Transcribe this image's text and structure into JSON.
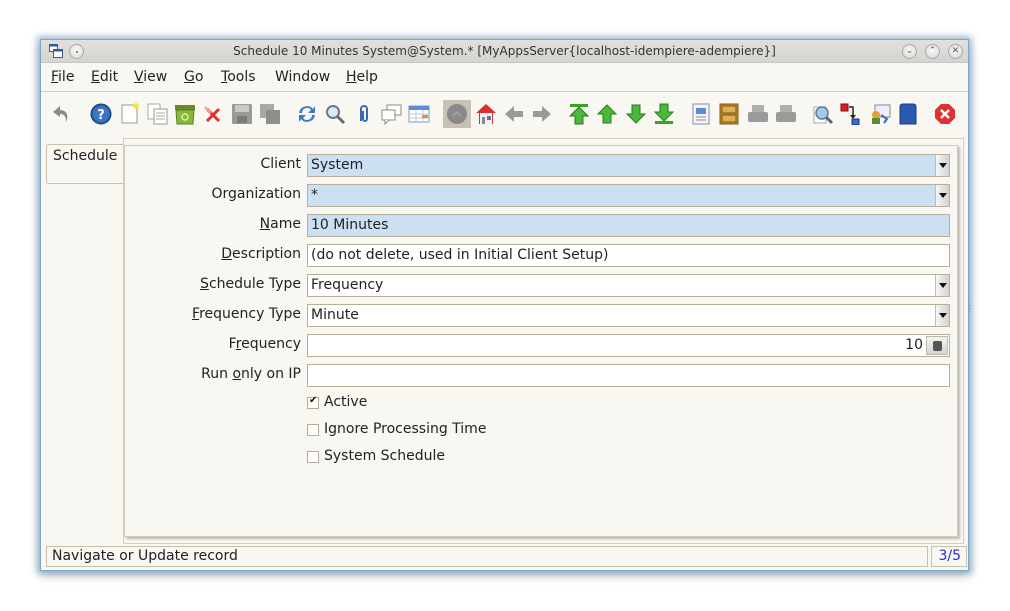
{
  "window": {
    "title": "Schedule  10 Minutes  System@System.* [MyAppsServer{localhost-idempiere-adempiere}]",
    "controls": {
      "minimize": "⌄",
      "maximize": "⌃",
      "close": "✕"
    }
  },
  "menubar": {
    "items": [
      {
        "mnemonic": "F",
        "rest": "ile"
      },
      {
        "mnemonic": "E",
        "rest": "dit"
      },
      {
        "mnemonic": "V",
        "rest": "iew"
      },
      {
        "mnemonic": "G",
        "rest": "o"
      },
      {
        "mnemonic": "T",
        "rest": "ools"
      },
      {
        "mnemonic": "",
        "rest": "Window"
      },
      {
        "mnemonic": "H",
        "rest": "elp"
      }
    ]
  },
  "toolbar": {
    "buttons": [
      "undo-icon",
      "help-icon",
      "new-record-icon",
      "copy-record-icon",
      "recycle-bin-icon",
      "delete-icon",
      "save-icon",
      "save-new-icon",
      "refresh-icon",
      "find-icon",
      "attachment-icon",
      "chat-icon",
      "grid-toggle-icon",
      "history-icon",
      "home-icon",
      "back-icon",
      "forward-icon",
      "first-record-icon",
      "previous-record-icon",
      "next-record-icon",
      "last-record-icon",
      "report-icon",
      "archive-icon",
      "print-preview-icon",
      "print-icon",
      "zoom-across-icon",
      "workflow-icon",
      "request-icon",
      "product-info-icon",
      "close-window-icon"
    ]
  },
  "tabs": [
    {
      "label": "Schedule"
    }
  ],
  "form": {
    "client": {
      "label": "Client",
      "mnemonic": "",
      "value": "System"
    },
    "organization": {
      "label": "Organization",
      "mnemonic": "",
      "value": "*"
    },
    "name": {
      "label_mn": "N",
      "label_rest": "ame",
      "value": "10 Minutes"
    },
    "description": {
      "label_mn": "D",
      "label_rest": "escription",
      "value": "(do not delete, used in Initial Client Setup)"
    },
    "schedule_type": {
      "label_mn": "S",
      "label_rest": "chedule Type",
      "value": "Frequency"
    },
    "frequency_type": {
      "label_mn": "F",
      "label_rest": "requency Type",
      "value": "Minute"
    },
    "frequency": {
      "label_pre": "F",
      "label_mn": "r",
      "label_rest": "equency",
      "value": "10"
    },
    "run_only_on_ip": {
      "label_pre": "Run ",
      "label_mn": "o",
      "label_rest": "nly on IP",
      "value": ""
    },
    "checkboxes": [
      {
        "label": "Active",
        "checked": true
      },
      {
        "label": "Ignore Processing Time",
        "checked": false
      },
      {
        "label": "System Schedule",
        "checked": false
      }
    ]
  },
  "status": {
    "message": "Navigate or Update record",
    "record_count": "3/5"
  }
}
